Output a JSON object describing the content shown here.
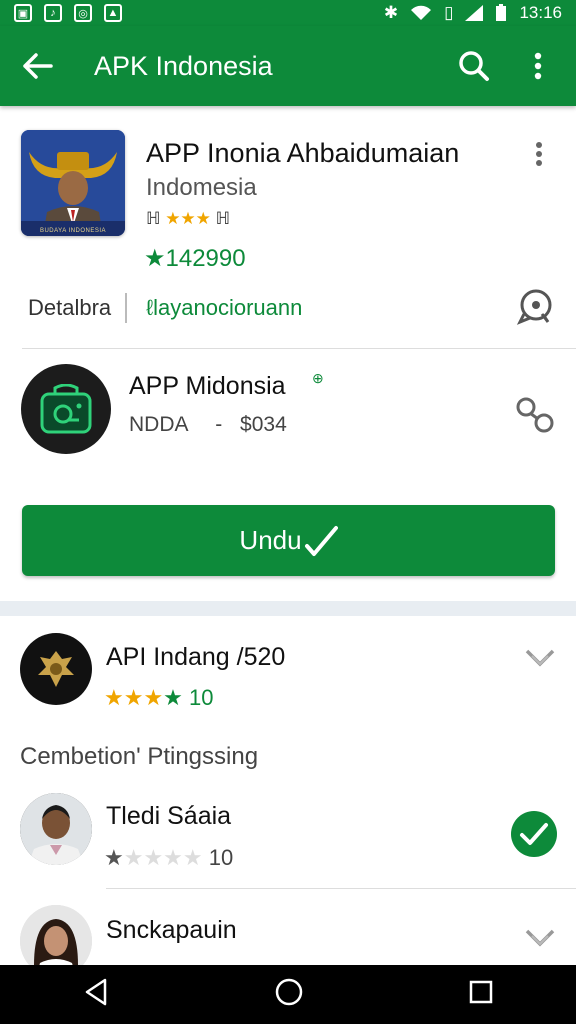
{
  "status_bar": {
    "time": "13:16"
  },
  "app_bar": {
    "title": "APK Indonesia"
  },
  "app": {
    "name": "APP Inonia Ahbaidumaian",
    "subtitle": "Indomesia",
    "small_rating_prefix": "ℍ",
    "small_rating_stars": "★★★",
    "small_rating_suffix": "ℍ",
    "downloads": "142990",
    "icon_banner": "BUDAYA INDONESIA"
  },
  "meta": {
    "left_label": "Detalbra",
    "right_label": "ℓlayanocioruann"
  },
  "developer": {
    "name": "APP Midonsia",
    "code": "NDDA",
    "separator": "-",
    "price": "$034"
  },
  "install": {
    "label": "Undu"
  },
  "reviews": {
    "section_label": "Cembetion' Ptingssing",
    "items": [
      {
        "title": "API Indang /520",
        "stars_filled": "★★★",
        "stars_green": "★",
        "stars_empty": "",
        "count": "10",
        "star_count": 4,
        "state": "collapsed"
      },
      {
        "title": "Tledi Sáaia",
        "stars_filled": "★",
        "stars_green": "",
        "stars_empty": "★★★★",
        "count": "10",
        "star_count": 1,
        "state": "checked"
      },
      {
        "title": "Snckapauin",
        "stars_filled": "",
        "stars_green": "",
        "stars_empty": "",
        "count": "",
        "star_count": 0,
        "state": "collapsed"
      }
    ]
  },
  "colors": {
    "primary": "#0d8a3a",
    "star": "#f0a500",
    "separator": "#e8edf2"
  }
}
